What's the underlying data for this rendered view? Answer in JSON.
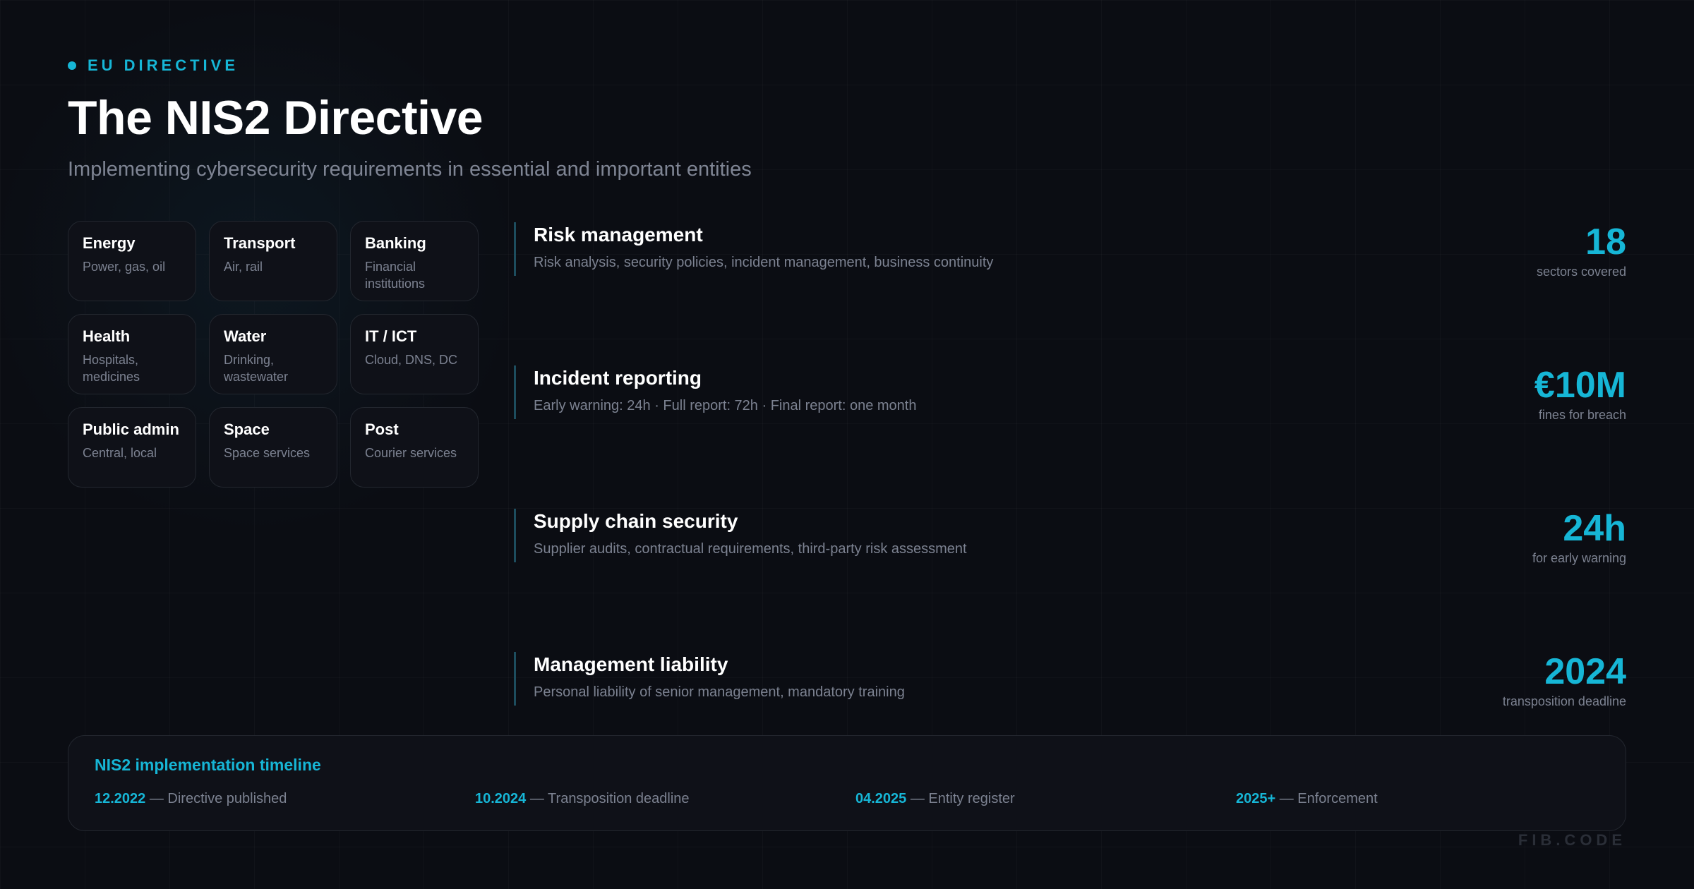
{
  "header": {
    "eyebrow": "EU DIRECTIVE",
    "title": "The NIS2 Directive",
    "subtitle": "Implementing cybersecurity requirements in essential and important entities"
  },
  "sectors": [
    {
      "name": "Energy",
      "desc": "Power, gas, oil"
    },
    {
      "name": "Transport",
      "desc": "Air, rail"
    },
    {
      "name": "Banking",
      "desc": "Financial institutions"
    },
    {
      "name": "Health",
      "desc": "Hospitals, medicines"
    },
    {
      "name": "Water",
      "desc": "Drinking, wastewater"
    },
    {
      "name": "IT / ICT",
      "desc": "Cloud, DNS, DC"
    },
    {
      "name": "Public admin",
      "desc": "Central, local"
    },
    {
      "name": "Space",
      "desc": "Space services"
    },
    {
      "name": "Post",
      "desc": "Courier services"
    }
  ],
  "requirements": [
    {
      "title": "Risk management",
      "desc": "Risk analysis, security policies, incident management, business continuity",
      "stat_value": "18",
      "stat_label": "sectors covered"
    },
    {
      "title": "Incident reporting",
      "desc": "Early warning: 24h · Full report: 72h · Final report: one month",
      "stat_value": "€10M",
      "stat_label": "fines for breach"
    },
    {
      "title": "Supply chain security",
      "desc": "Supplier audits, contractual requirements, third-party risk assessment",
      "stat_value": "24h",
      "stat_label": "for early warning"
    },
    {
      "title": "Management liability",
      "desc": "Personal liability of senior management, mandatory training",
      "stat_value": "2024",
      "stat_label": "transposition deadline"
    }
  ],
  "timeline": {
    "title": "NIS2 implementation timeline",
    "events": [
      {
        "date": "12.2022",
        "label": "— Directive published"
      },
      {
        "date": "10.2024",
        "label": "— Transposition deadline"
      },
      {
        "date": "04.2025",
        "label": "— Entity register"
      },
      {
        "date": "2025+",
        "label": "— Enforcement"
      }
    ]
  },
  "brand": "FIB.CODE",
  "colors": {
    "accent": "#16b6d6",
    "background": "#0b0d13",
    "muted_text": "#7c8291"
  }
}
